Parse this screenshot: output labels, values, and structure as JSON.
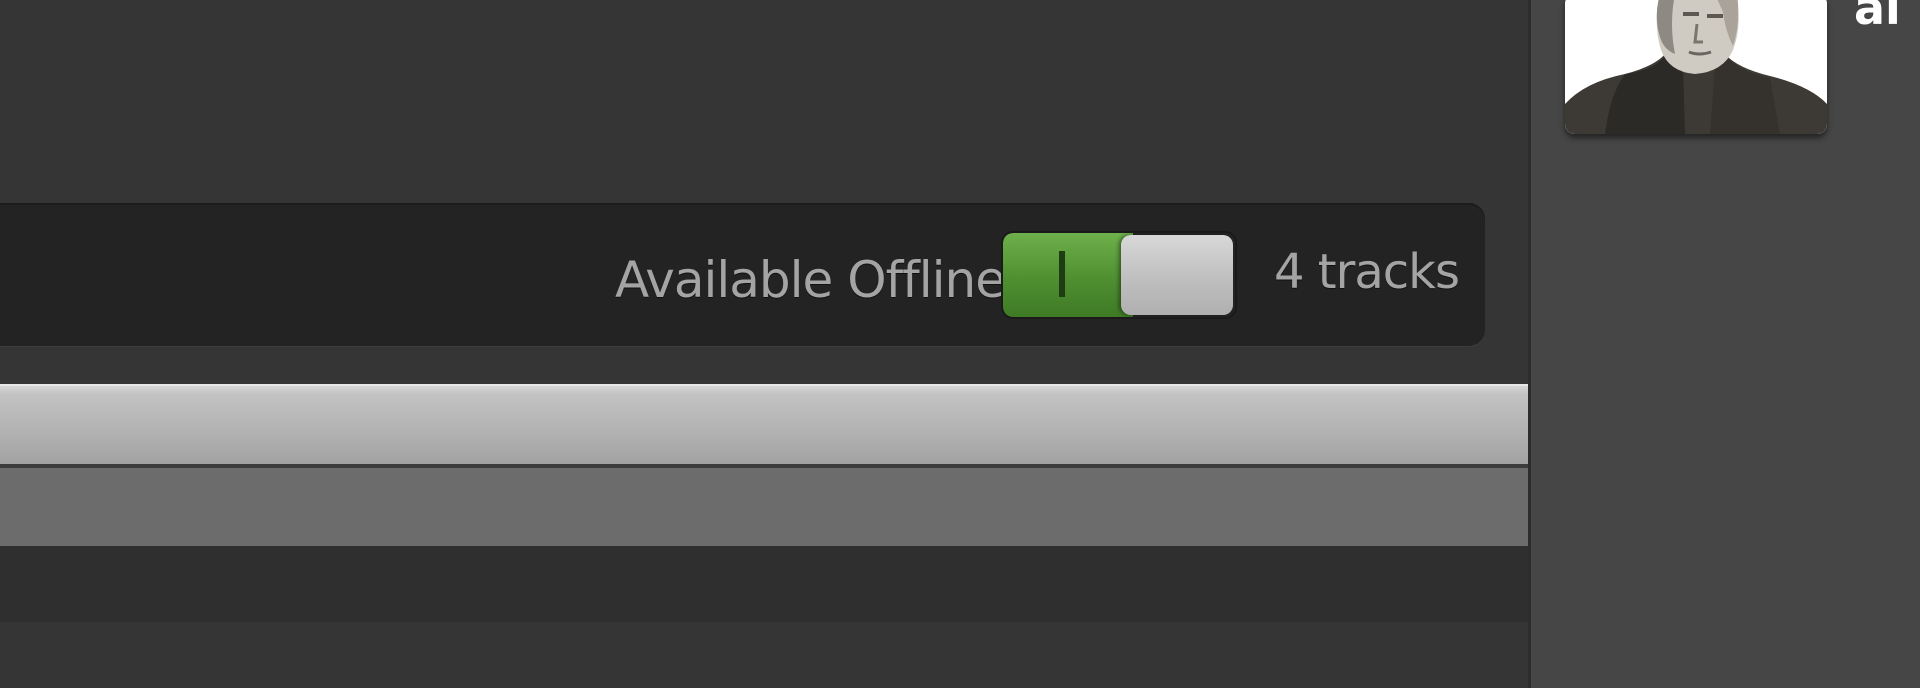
{
  "playlist": {
    "offline_label": "Available Offline",
    "offline_enabled": true,
    "toggle_on_glyph": "I",
    "track_count": "4 tracks"
  },
  "profile": {
    "username": "ai",
    "avatar_icon": "user-avatar-photo"
  },
  "colors": {
    "toggle_on": "#5a9a3a",
    "toggle_knob": "#c8c8c8",
    "panel": "#232323",
    "background": "#353535",
    "sidebar": "#464646"
  }
}
